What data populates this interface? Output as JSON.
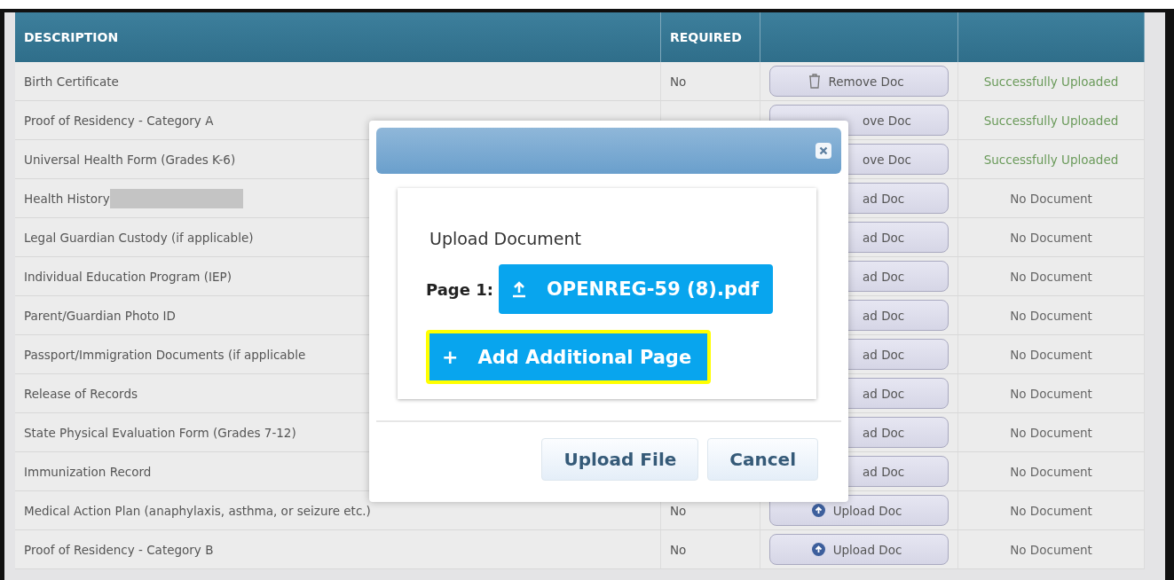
{
  "table": {
    "columns": [
      "DESCRIPTION",
      "REQUIRED"
    ],
    "rows": [
      {
        "description": "Birth Certificate",
        "redacted": false,
        "required": "No",
        "button": {
          "kind": "remove",
          "label": "Remove Doc",
          "covered": false
        },
        "status": "Successfully Uploaded",
        "uploaded": true
      },
      {
        "description": "Proof of Residency - Category A",
        "redacted": false,
        "button": {
          "kind": "remove",
          "label": "ove Doc",
          "covered": true
        },
        "status": "Successfully Uploaded",
        "uploaded": true
      },
      {
        "description": "Universal Health Form (Grades K-6)",
        "redacted": false,
        "button": {
          "kind": "remove",
          "label": "ove Doc",
          "covered": true
        },
        "status": "Successfully Uploaded",
        "uploaded": true
      },
      {
        "description": "Health History",
        "redacted": true,
        "button": {
          "kind": "upload",
          "label": "ad Doc",
          "covered": true
        },
        "status": "No Document",
        "uploaded": false
      },
      {
        "description": "Legal Guardian Custody (if applicable)",
        "redacted": false,
        "button": {
          "kind": "upload",
          "label": "ad Doc",
          "covered": true
        },
        "status": "No Document",
        "uploaded": false
      },
      {
        "description": "Individual Education Program (IEP)",
        "redacted": false,
        "button": {
          "kind": "upload",
          "label": "ad Doc",
          "covered": true
        },
        "status": "No Document",
        "uploaded": false
      },
      {
        "description": "Parent/Guardian Photo ID",
        "redacted": false,
        "button": {
          "kind": "upload",
          "label": "ad Doc",
          "covered": true
        },
        "status": "No Document",
        "uploaded": false
      },
      {
        "description": "Passport/Immigration Documents (if applicable",
        "redacted": false,
        "button": {
          "kind": "upload",
          "label": "ad Doc",
          "covered": true
        },
        "status": "No Document",
        "uploaded": false
      },
      {
        "description": "Release of Records",
        "redacted": false,
        "button": {
          "kind": "upload",
          "label": "ad Doc",
          "covered": true
        },
        "status": "No Document",
        "uploaded": false
      },
      {
        "description": "State Physical Evaluation Form (Grades 7-12)",
        "redacted": false,
        "button": {
          "kind": "upload",
          "label": "ad Doc",
          "covered": true
        },
        "status": "No Document",
        "uploaded": false
      },
      {
        "description": "Immunization Record",
        "redacted": false,
        "button": {
          "kind": "upload",
          "label": "ad Doc",
          "covered": true
        },
        "status": "No Document",
        "uploaded": false
      },
      {
        "description": "Medical Action Plan (anaphylaxis, asthma, or seizure etc.)",
        "redacted": false,
        "required": "No",
        "button": {
          "kind": "upload",
          "label": "Upload Doc",
          "covered": false
        },
        "status": "No Document",
        "uploaded": false
      },
      {
        "description": "Proof of Residency - Category B",
        "redacted": false,
        "required": "No",
        "button": {
          "kind": "upload",
          "label": "Upload Doc",
          "covered": false
        },
        "status": "No Document",
        "uploaded": false
      }
    ]
  },
  "dialog": {
    "heading": "Upload Document",
    "page_label": "Page 1:",
    "file_name": "OPENREG-59 (8).pdf",
    "add_page": {
      "icon": "+",
      "label": "Add Additional Page",
      "highlighted": true
    },
    "buttons": [
      "Upload File",
      "Cancel"
    ]
  }
}
